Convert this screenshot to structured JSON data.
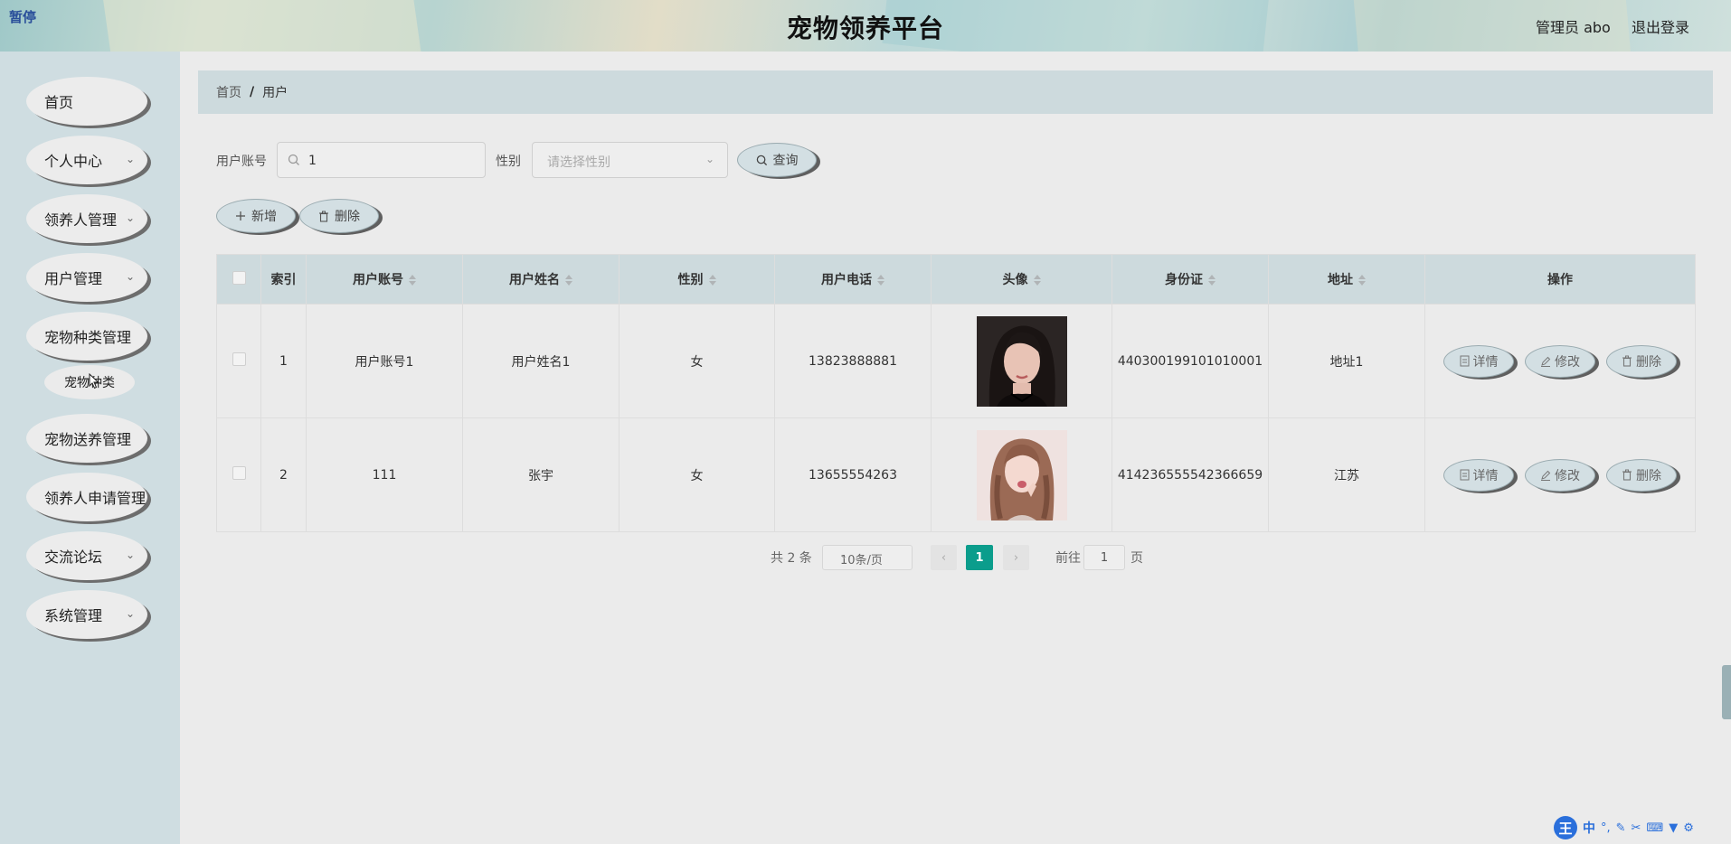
{
  "header": {
    "pause_tag": "暂停",
    "site_title": "宠物领养平台",
    "admin_info": "管理员 abo",
    "logout": "退出登录"
  },
  "sidebar": {
    "items": [
      {
        "label": "首页"
      },
      {
        "label": "个人中心"
      },
      {
        "label": "领养人管理"
      },
      {
        "label": "用户管理"
      },
      {
        "label": "宠物种类管理"
      },
      {
        "label": "宠物送养管理"
      },
      {
        "label": "领养人申请管理"
      },
      {
        "label": "交流论坛"
      },
      {
        "label": "系统管理"
      }
    ],
    "submenu_item": "宠物种类"
  },
  "breadcrumb": {
    "home": "首页",
    "separator": "/",
    "current": "用户"
  },
  "search": {
    "account_label": "用户账号",
    "account_value": "1",
    "gender_label": "性别",
    "gender_placeholder": "请选择性别",
    "query_button": "查询"
  },
  "toolbar": {
    "add_button": "新增",
    "delete_button": "删除"
  },
  "table": {
    "columns": [
      "索引",
      "用户账号",
      "用户姓名",
      "性别",
      "用户电话",
      "头像",
      "身份证",
      "地址",
      "操作"
    ],
    "rows": [
      {
        "index": "1",
        "account": "用户账号1",
        "name": "用户姓名1",
        "gender": "女",
        "phone": "13823888881",
        "id_card": "440300199101010001",
        "address": "地址1"
      },
      {
        "index": "2",
        "account": "111",
        "name": "张宇",
        "gender": "女",
        "phone": "13655554263",
        "id_card": "414236555542366659",
        "address": "江苏"
      }
    ],
    "actions": {
      "detail": "详情",
      "edit": "修改",
      "delete": "删除"
    }
  },
  "pagination": {
    "total": "共 2 条",
    "page_size": "10条/页",
    "current_page": "1",
    "goto_label": "前往",
    "goto_value": "1",
    "page_suffix": "页"
  },
  "ime": {
    "logo": "王",
    "mode": "中"
  },
  "colors": {
    "accent": "#0b9d8c",
    "sidebar_bg": "#cfdde1",
    "header_bar": "#cddadd"
  }
}
